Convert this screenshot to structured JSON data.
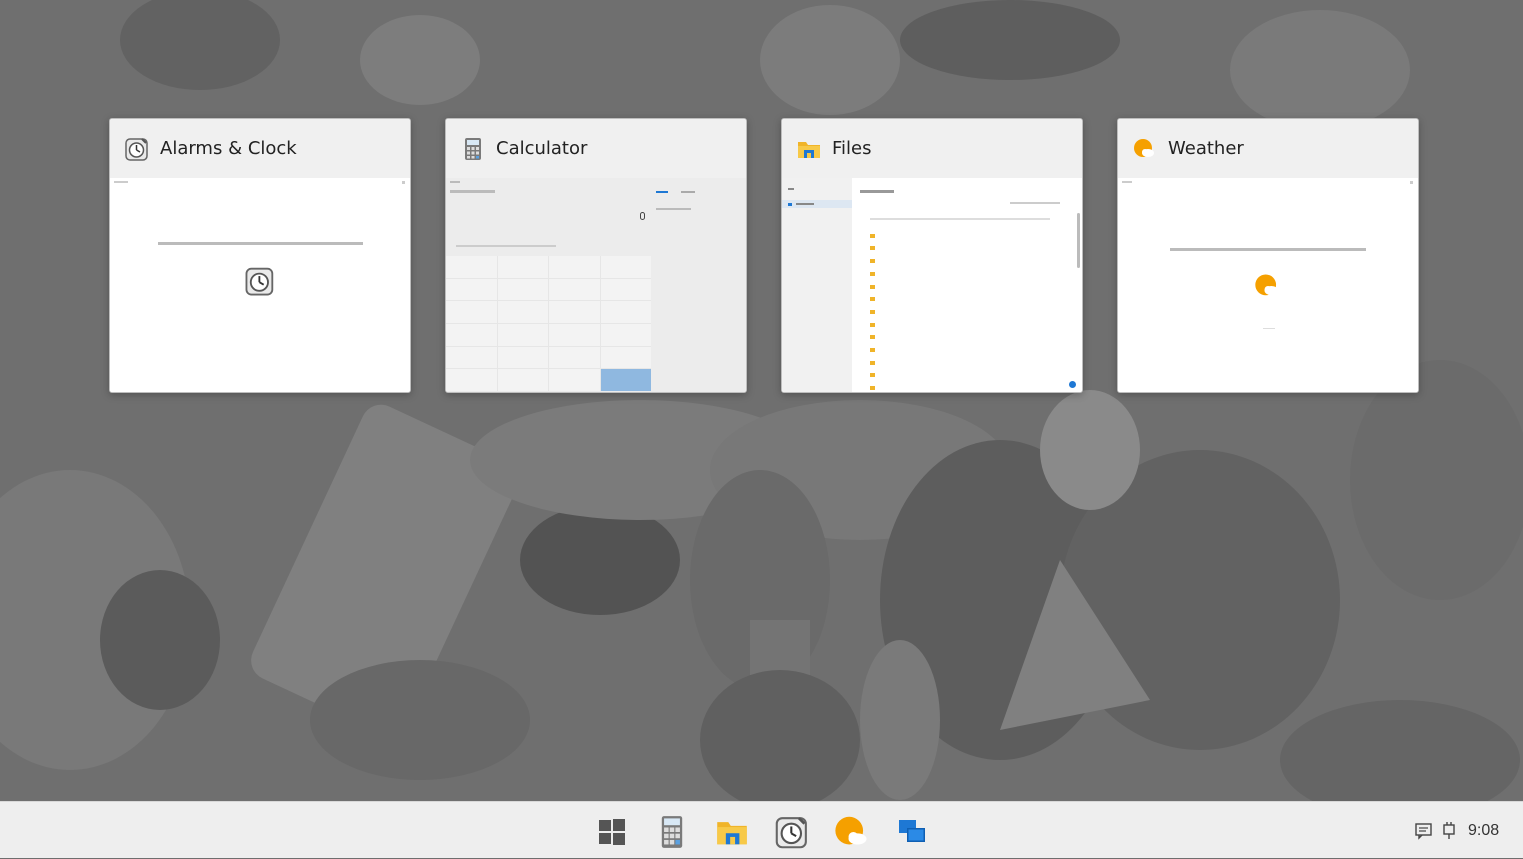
{
  "task_view": {
    "cards": [
      {
        "title": "Alarms & Clock",
        "icon": "alarm-clock-icon"
      },
      {
        "title": "Calculator",
        "icon": "calculator-icon"
      },
      {
        "title": "Files",
        "icon": "folder-icon"
      },
      {
        "title": "Weather",
        "icon": "weather-icon"
      }
    ]
  },
  "taskbar": {
    "pinned": [
      {
        "name": "start-button",
        "icon": "windows-logo-icon"
      },
      {
        "name": "calculator-taskbar-button",
        "icon": "calculator-icon"
      },
      {
        "name": "files-taskbar-button",
        "icon": "folder-icon"
      },
      {
        "name": "alarms-clock-taskbar-button",
        "icon": "alarm-clock-icon"
      },
      {
        "name": "weather-taskbar-button",
        "icon": "weather-icon"
      },
      {
        "name": "task-view-button",
        "icon": "task-view-icon"
      }
    ],
    "clock": "9:08"
  },
  "colors": {
    "taskbar_bg": "#eeeeee",
    "card_header_bg": "#f0f0f0",
    "accent_blue": "#1e78d4",
    "weather_orange": "#f5a000",
    "folder_yellow": "#f0b429"
  }
}
